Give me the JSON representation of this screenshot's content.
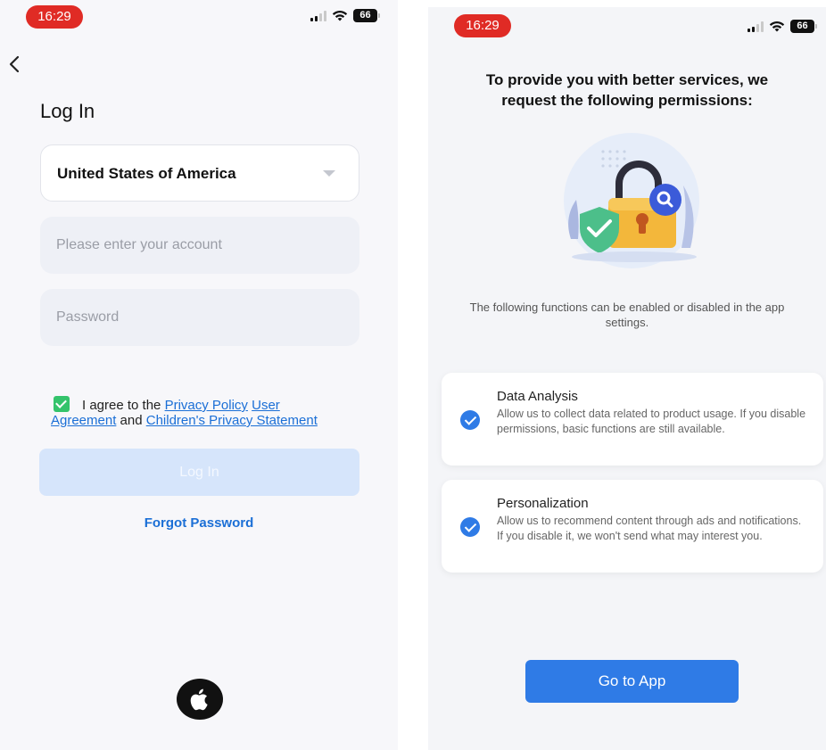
{
  "status_bar": {
    "time": "16:29",
    "battery": "66"
  },
  "login_screen": {
    "title": "Log In",
    "country": "United States of America",
    "account_placeholder": "Please enter your account",
    "password_placeholder": "Password",
    "agreement": {
      "prefix": "I agree to the",
      "privacy_policy": "Privacy Policy",
      "user_agreement_1": "User",
      "user_agreement_2": "Agreement",
      "and": "and",
      "childrens_privacy": "Children's Privacy Statement"
    },
    "login_button": "Log In",
    "forgot_password": "Forgot Password"
  },
  "permissions_screen": {
    "title": "To provide you with better services, we request the following permissions:",
    "subtitle": "The following functions can be enabled or disabled in the app settings.",
    "items": [
      {
        "title": "Data Analysis",
        "description": "Allow us to collect data related to product usage. If you disable permissions, basic functions are still available."
      },
      {
        "title": "Personalization",
        "description": "Allow us to recommend content through ads and notifications. If you disable it, we won't send what may interest you."
      }
    ],
    "go_button": "Go to App"
  },
  "colors": {
    "accent": "#2f7be6",
    "link": "#1b6fd6",
    "checkbox_green": "#34c36b",
    "time_pill": "#e02b25",
    "login_disabled": "#d6e5fb"
  }
}
